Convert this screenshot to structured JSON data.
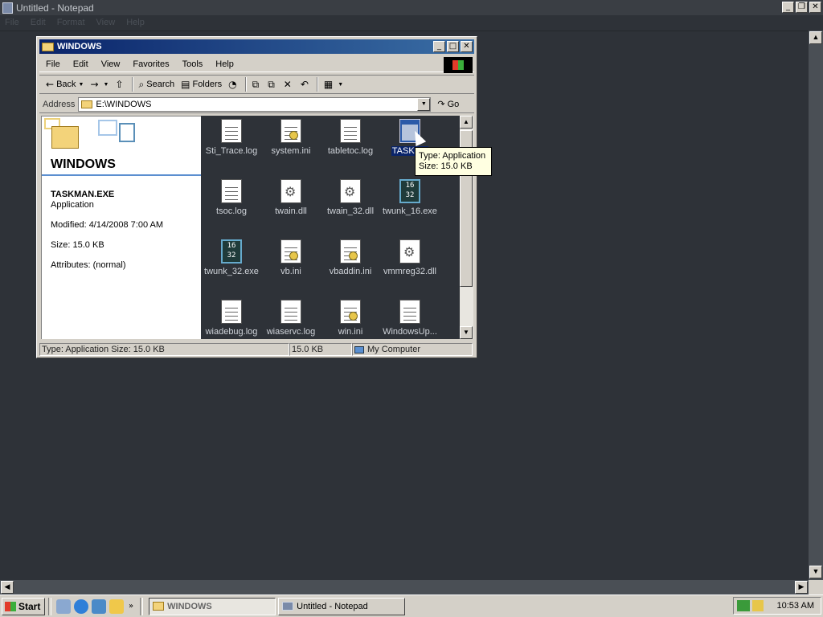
{
  "notepad": {
    "title": "Untitled - Notepad",
    "menu": [
      "File",
      "Edit",
      "Format",
      "View",
      "Help"
    ]
  },
  "explorer": {
    "title": "WINDOWS",
    "menu": [
      "File",
      "Edit",
      "View",
      "Favorites",
      "Tools",
      "Help"
    ],
    "toolbar": {
      "back": "Back",
      "search": "Search",
      "folders": "Folders"
    },
    "address": {
      "label": "Address",
      "value": "E:\\WINDOWS",
      "go": "Go"
    },
    "left_panel": {
      "folder_name": "WINDOWS",
      "selected_name": "TASKMAN.EXE",
      "selected_type": "Application",
      "modified": "Modified: 4/14/2008 7:00 AM",
      "size": "Size: 15.0 KB",
      "attributes": "Attributes: (normal)"
    },
    "files": [
      {
        "name": "Sti_Trace.log",
        "icon": "text-document-icon"
      },
      {
        "name": "system.ini",
        "icon": "config-file-icon"
      },
      {
        "name": "tabletoc.log",
        "icon": "text-document-icon"
      },
      {
        "name": "TASKMA",
        "icon": "application-window-icon",
        "selected": true
      },
      {
        "name": "tsoc.log",
        "icon": "text-document-icon"
      },
      {
        "name": "twain.dll",
        "icon": "dll-gear-icon"
      },
      {
        "name": "twain_32.dll",
        "icon": "dll-gear-icon"
      },
      {
        "name": "twunk_16.exe",
        "icon": "exe-16-32-icon"
      },
      {
        "name": "twunk_32.exe",
        "icon": "exe-16-32-icon"
      },
      {
        "name": "vb.ini",
        "icon": "config-file-icon"
      },
      {
        "name": "vbaddin.ini",
        "icon": "config-file-icon"
      },
      {
        "name": "vmmreg32.dll",
        "icon": "dll-gear-icon"
      },
      {
        "name": "wiadebug.log",
        "icon": "text-document-icon"
      },
      {
        "name": "wiaservc.log",
        "icon": "text-document-icon"
      },
      {
        "name": "win.ini",
        "icon": "config-file-icon"
      },
      {
        "name": "WindowsUp...",
        "icon": "text-document-icon"
      }
    ],
    "tooltip": {
      "line1": "Type: Application",
      "line2": "Size: 15.0 KB"
    },
    "status": {
      "left": "Type: Application Size: 15.0 KB",
      "size": "15.0 KB",
      "zone": "My Computer"
    }
  },
  "taskbar": {
    "start": "Start",
    "tasks": [
      {
        "label": "WINDOWS",
        "active": true
      },
      {
        "label": "Untitled - Notepad",
        "active": false
      }
    ],
    "clock": "10:53 AM",
    "more": "»"
  }
}
